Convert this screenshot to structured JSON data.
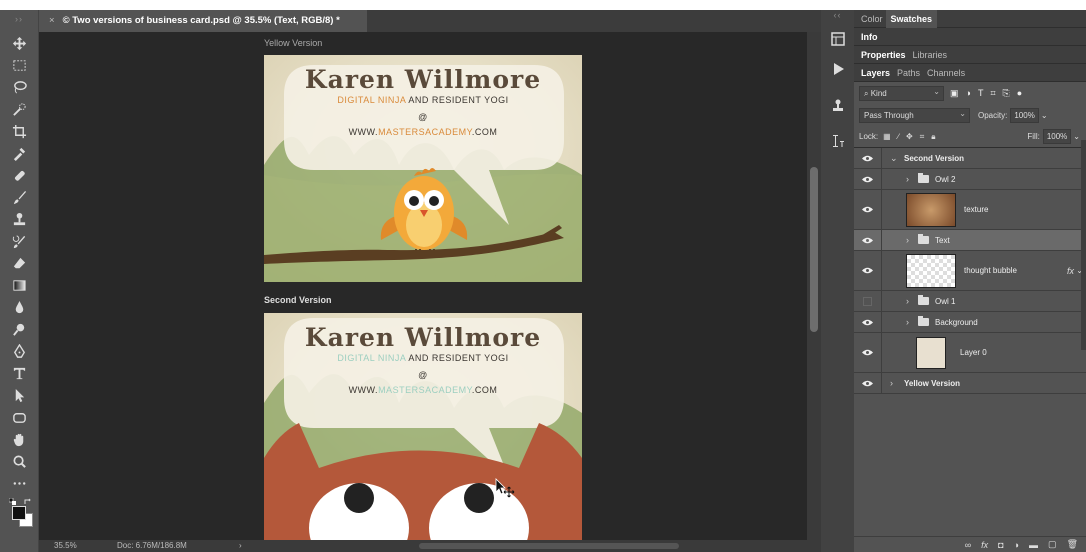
{
  "document": {
    "tab_title": "© Two versions of business card.psd @ 35.5% (Text, RGB/8) *",
    "zoom": "35.5%",
    "doc_size": "Doc: 6.76M/186.8M",
    "status_arrow": "›"
  },
  "artboards": [
    {
      "label": "Yellow Version",
      "name": "Karen Willmore",
      "tagline_a": "DIGITAL NINJA",
      "tagline_b": "AND RESIDENT YOGI",
      "at": "@",
      "web_a": "WWW.",
      "web_b": "MASTERSACADEMY",
      "web_c": ".COM"
    },
    {
      "label": "Second Version",
      "name": "Karen Willmore",
      "tagline_a": "DIGITAL NINJA",
      "tagline_b": "AND RESIDENT YOGI",
      "at": "@",
      "web_a": "WWW.",
      "web_b": "MASTERSACADEMY",
      "web_c": ".COM"
    }
  ],
  "panels": {
    "tabs_row1": [
      "Color",
      "Swatches"
    ],
    "tabs_row2": [
      "Info"
    ],
    "tabs_row3": [
      "Properties",
      "Libraries"
    ],
    "tabs_row4": [
      "Layers",
      "Paths",
      "Channels"
    ],
    "filter_kind": "Kind",
    "blend_mode": "Pass Through",
    "opacity_label": "Opacity:",
    "opacity_value": "100%",
    "lock_label": "Lock:",
    "fill_label": "Fill:",
    "fill_value": "100%"
  },
  "layers": [
    {
      "name": "Second Version",
      "type": "group",
      "indent": 0,
      "expanded": true,
      "visible": true,
      "bold": true
    },
    {
      "name": "Owl 2",
      "type": "group",
      "indent": 1,
      "visible": true
    },
    {
      "name": "texture",
      "type": "pixel",
      "indent": 1,
      "visible": true
    },
    {
      "name": "Text",
      "type": "group",
      "indent": 1,
      "visible": true,
      "selected": true
    },
    {
      "name": "thought bubble",
      "type": "pixel",
      "indent": 1,
      "visible": true,
      "fx": "fx"
    },
    {
      "name": "Owl 1",
      "type": "group",
      "indent": 1,
      "visible": false
    },
    {
      "name": "Background",
      "type": "group",
      "indent": 1,
      "visible": true
    },
    {
      "name": "Layer 0",
      "type": "pixel",
      "indent": 1,
      "visible": true
    },
    {
      "name": "Yellow Version",
      "type": "group",
      "indent": 0,
      "expanded": false,
      "visible": true,
      "bold": true
    }
  ],
  "layer_footer_icons": [
    "link-icon",
    "fx-icon",
    "mask-icon",
    "adjustment-icon",
    "new-group-icon",
    "new-layer-icon",
    "trash-icon"
  ],
  "footer_glyphs": {
    "link": "∞",
    "fx": "fx",
    "mask": "◘",
    "adjust": "◑",
    "group": "▬",
    "new": "▢",
    "trash": "🗑"
  },
  "toolbar_tools": [
    "move-tool-icon",
    "marquee-tool-icon",
    "lasso-tool-icon",
    "quick-select-tool-icon",
    "crop-tool-icon",
    "eyedropper-tool-icon",
    "healing-brush-tool-icon",
    "brush-tool-icon",
    "clone-stamp-tool-icon",
    "history-brush-tool-icon",
    "eraser-tool-icon",
    "gradient-tool-icon",
    "blur-tool-icon",
    "dodge-tool-icon",
    "pen-tool-icon",
    "type-tool-icon",
    "path-select-tool-icon",
    "shape-tool-icon",
    "hand-tool-icon",
    "zoom-tool-icon",
    "more-tools-icon"
  ],
  "colors": {
    "foreground": "#111111",
    "background": "#ffffff"
  }
}
